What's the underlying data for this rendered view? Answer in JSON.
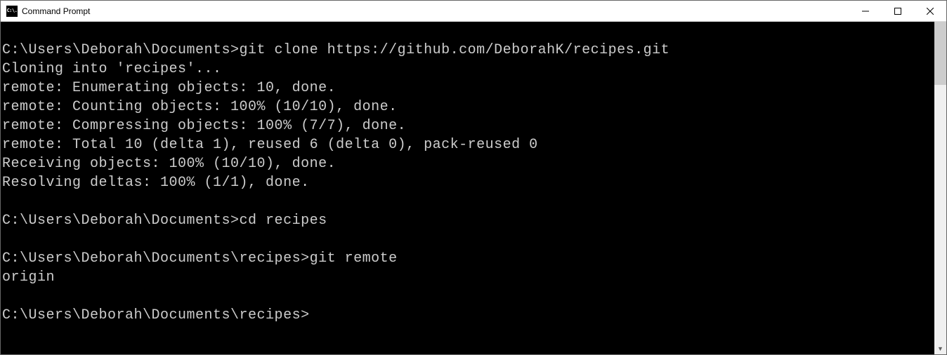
{
  "titlebar": {
    "icon_text": "C:\\.",
    "app_name": "Command Prompt"
  },
  "terminal": {
    "lines": [
      "",
      "C:\\Users\\Deborah\\Documents>git clone https://github.com/DeborahK/recipes.git",
      "Cloning into 'recipes'...",
      "remote: Enumerating objects: 10, done.",
      "remote: Counting objects: 100% (10/10), done.",
      "remote: Compressing objects: 100% (7/7), done.",
      "remote: Total 10 (delta 1), reused 6 (delta 0), pack-reused 0",
      "Receiving objects: 100% (10/10), done.",
      "Resolving deltas: 100% (1/1), done.",
      "",
      "C:\\Users\\Deborah\\Documents>cd recipes",
      "",
      "C:\\Users\\Deborah\\Documents\\recipes>git remote",
      "origin",
      "",
      "C:\\Users\\Deborah\\Documents\\recipes>"
    ]
  }
}
